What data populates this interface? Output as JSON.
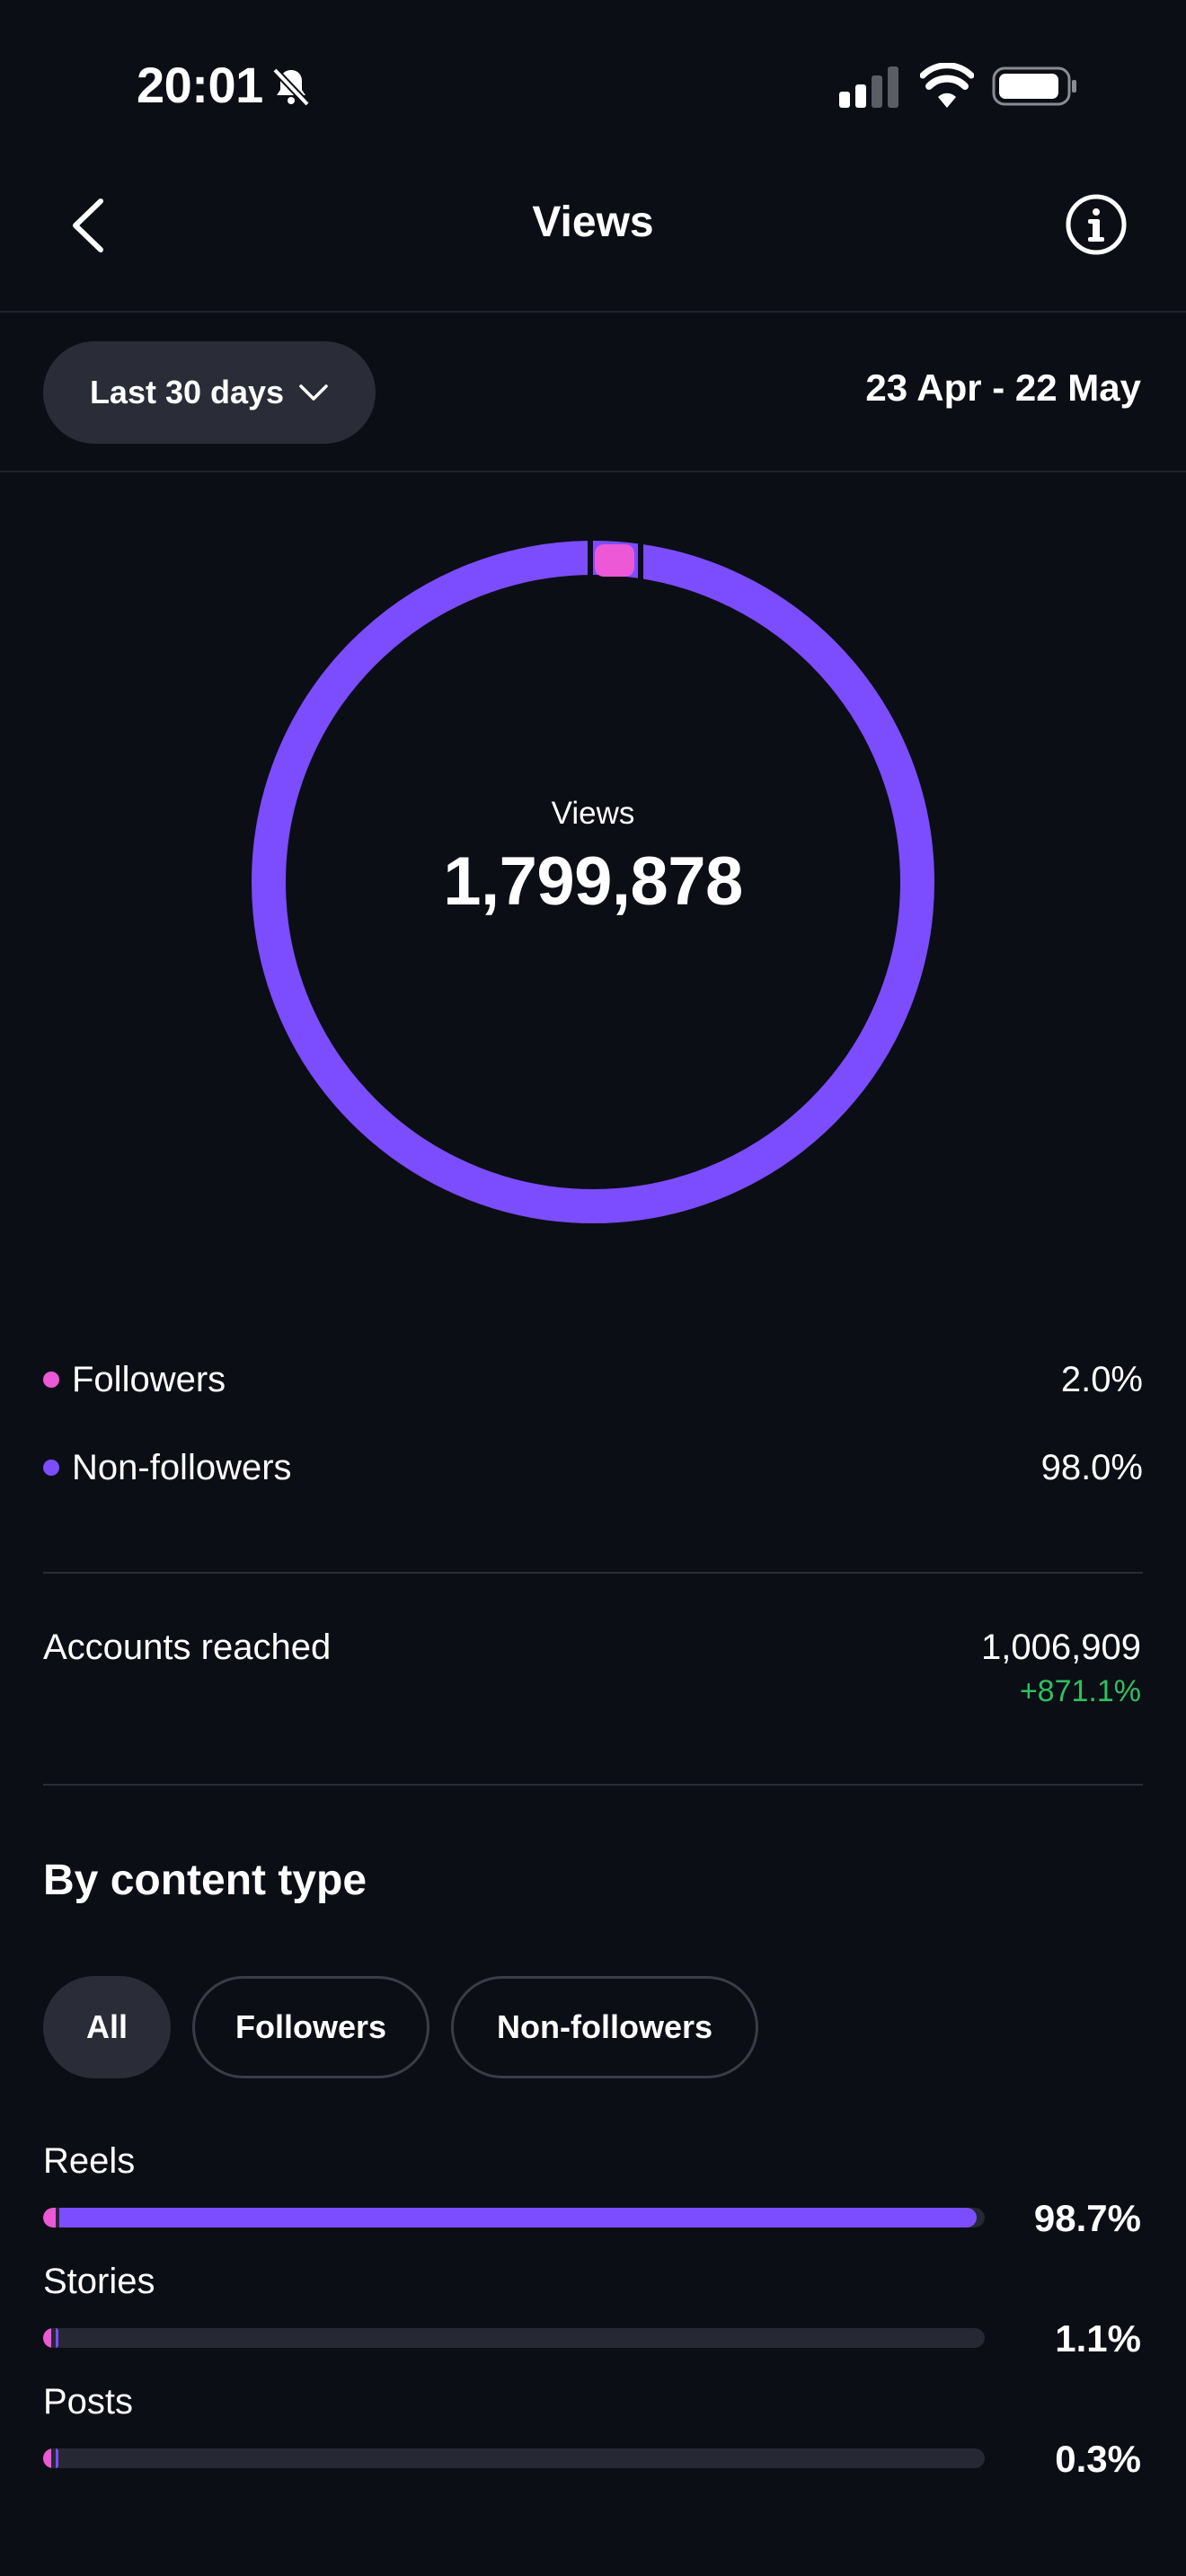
{
  "status_bar": {
    "time": "20:01"
  },
  "header": {
    "title": "Views"
  },
  "filter": {
    "range_label": "Last 30 days",
    "date_range": "23 Apr - 22 May"
  },
  "summary": {
    "label": "Views",
    "value": "1,799,878"
  },
  "legend": [
    {
      "label": "Followers",
      "value": "2.0%",
      "color": "#ec58d6"
    },
    {
      "label": "Non-followers",
      "value": "98.0%",
      "color": "#7b4dff"
    }
  ],
  "reached": {
    "label": "Accounts reached",
    "value": "1,006,909",
    "change": "+871.1%"
  },
  "content_type": {
    "title": "By content type",
    "chips": [
      "All",
      "Followers",
      "Non-followers"
    ],
    "items": [
      {
        "label": "Reels",
        "percent": "98.7%",
        "followers_fraction": 0.013,
        "nonfollowers_fraction": 0.974
      },
      {
        "label": "Stories",
        "percent": "1.1%",
        "followers_fraction": 0.008,
        "nonfollowers_fraction": 0.003
      },
      {
        "label": "Posts",
        "percent": "0.3%",
        "followers_fraction": 0.001,
        "nonfollowers_fraction": 0.002
      }
    ]
  },
  "colors": {
    "background": "#0c0e15",
    "followers": "#ec58d6",
    "non_followers": "#7b4dff",
    "positive": "#2fbf62"
  },
  "icons": {
    "back": "chevron-left-icon",
    "info": "info-circle-icon",
    "dropdown": "chevron-down-icon",
    "mute": "bell-slash-icon",
    "signal": "cellular-signal-icon",
    "wifi": "wifi-icon",
    "battery": "battery-icon"
  }
}
